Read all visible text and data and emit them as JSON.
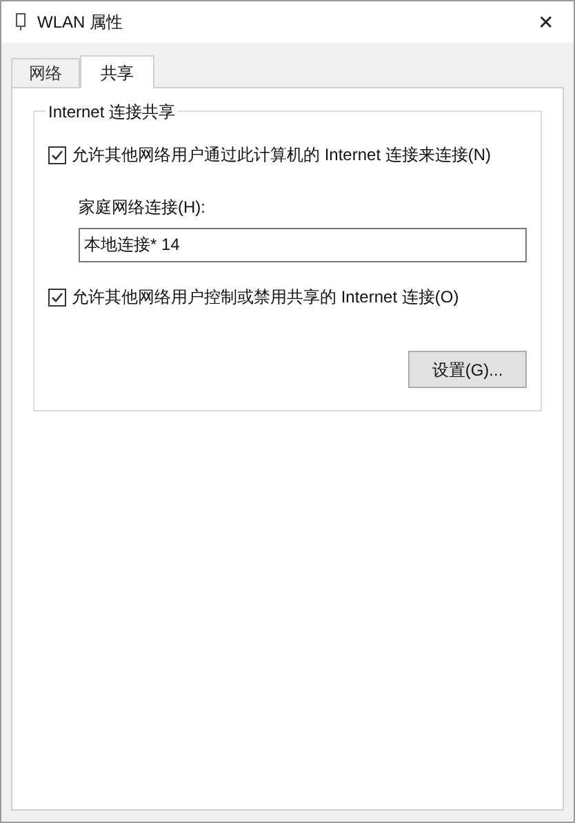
{
  "window": {
    "title": "WLAN 属性",
    "close": "✕"
  },
  "tabs": [
    {
      "label": "网络",
      "selected": false
    },
    {
      "label": "共享",
      "selected": true
    }
  ],
  "group": {
    "title": "Internet 连接共享",
    "allow_sharing": {
      "label": "允许其他网络用户通过此计算机的 Internet 连接来连接(N)",
      "checked": true
    },
    "home_connection": {
      "label": "家庭网络连接(H):",
      "value": "本地连接* 14"
    },
    "allow_control": {
      "label": "允许其他网络用户控制或禁用共享的 Internet 连接(O)",
      "checked": true
    },
    "settings_button": "设置(G)..."
  }
}
